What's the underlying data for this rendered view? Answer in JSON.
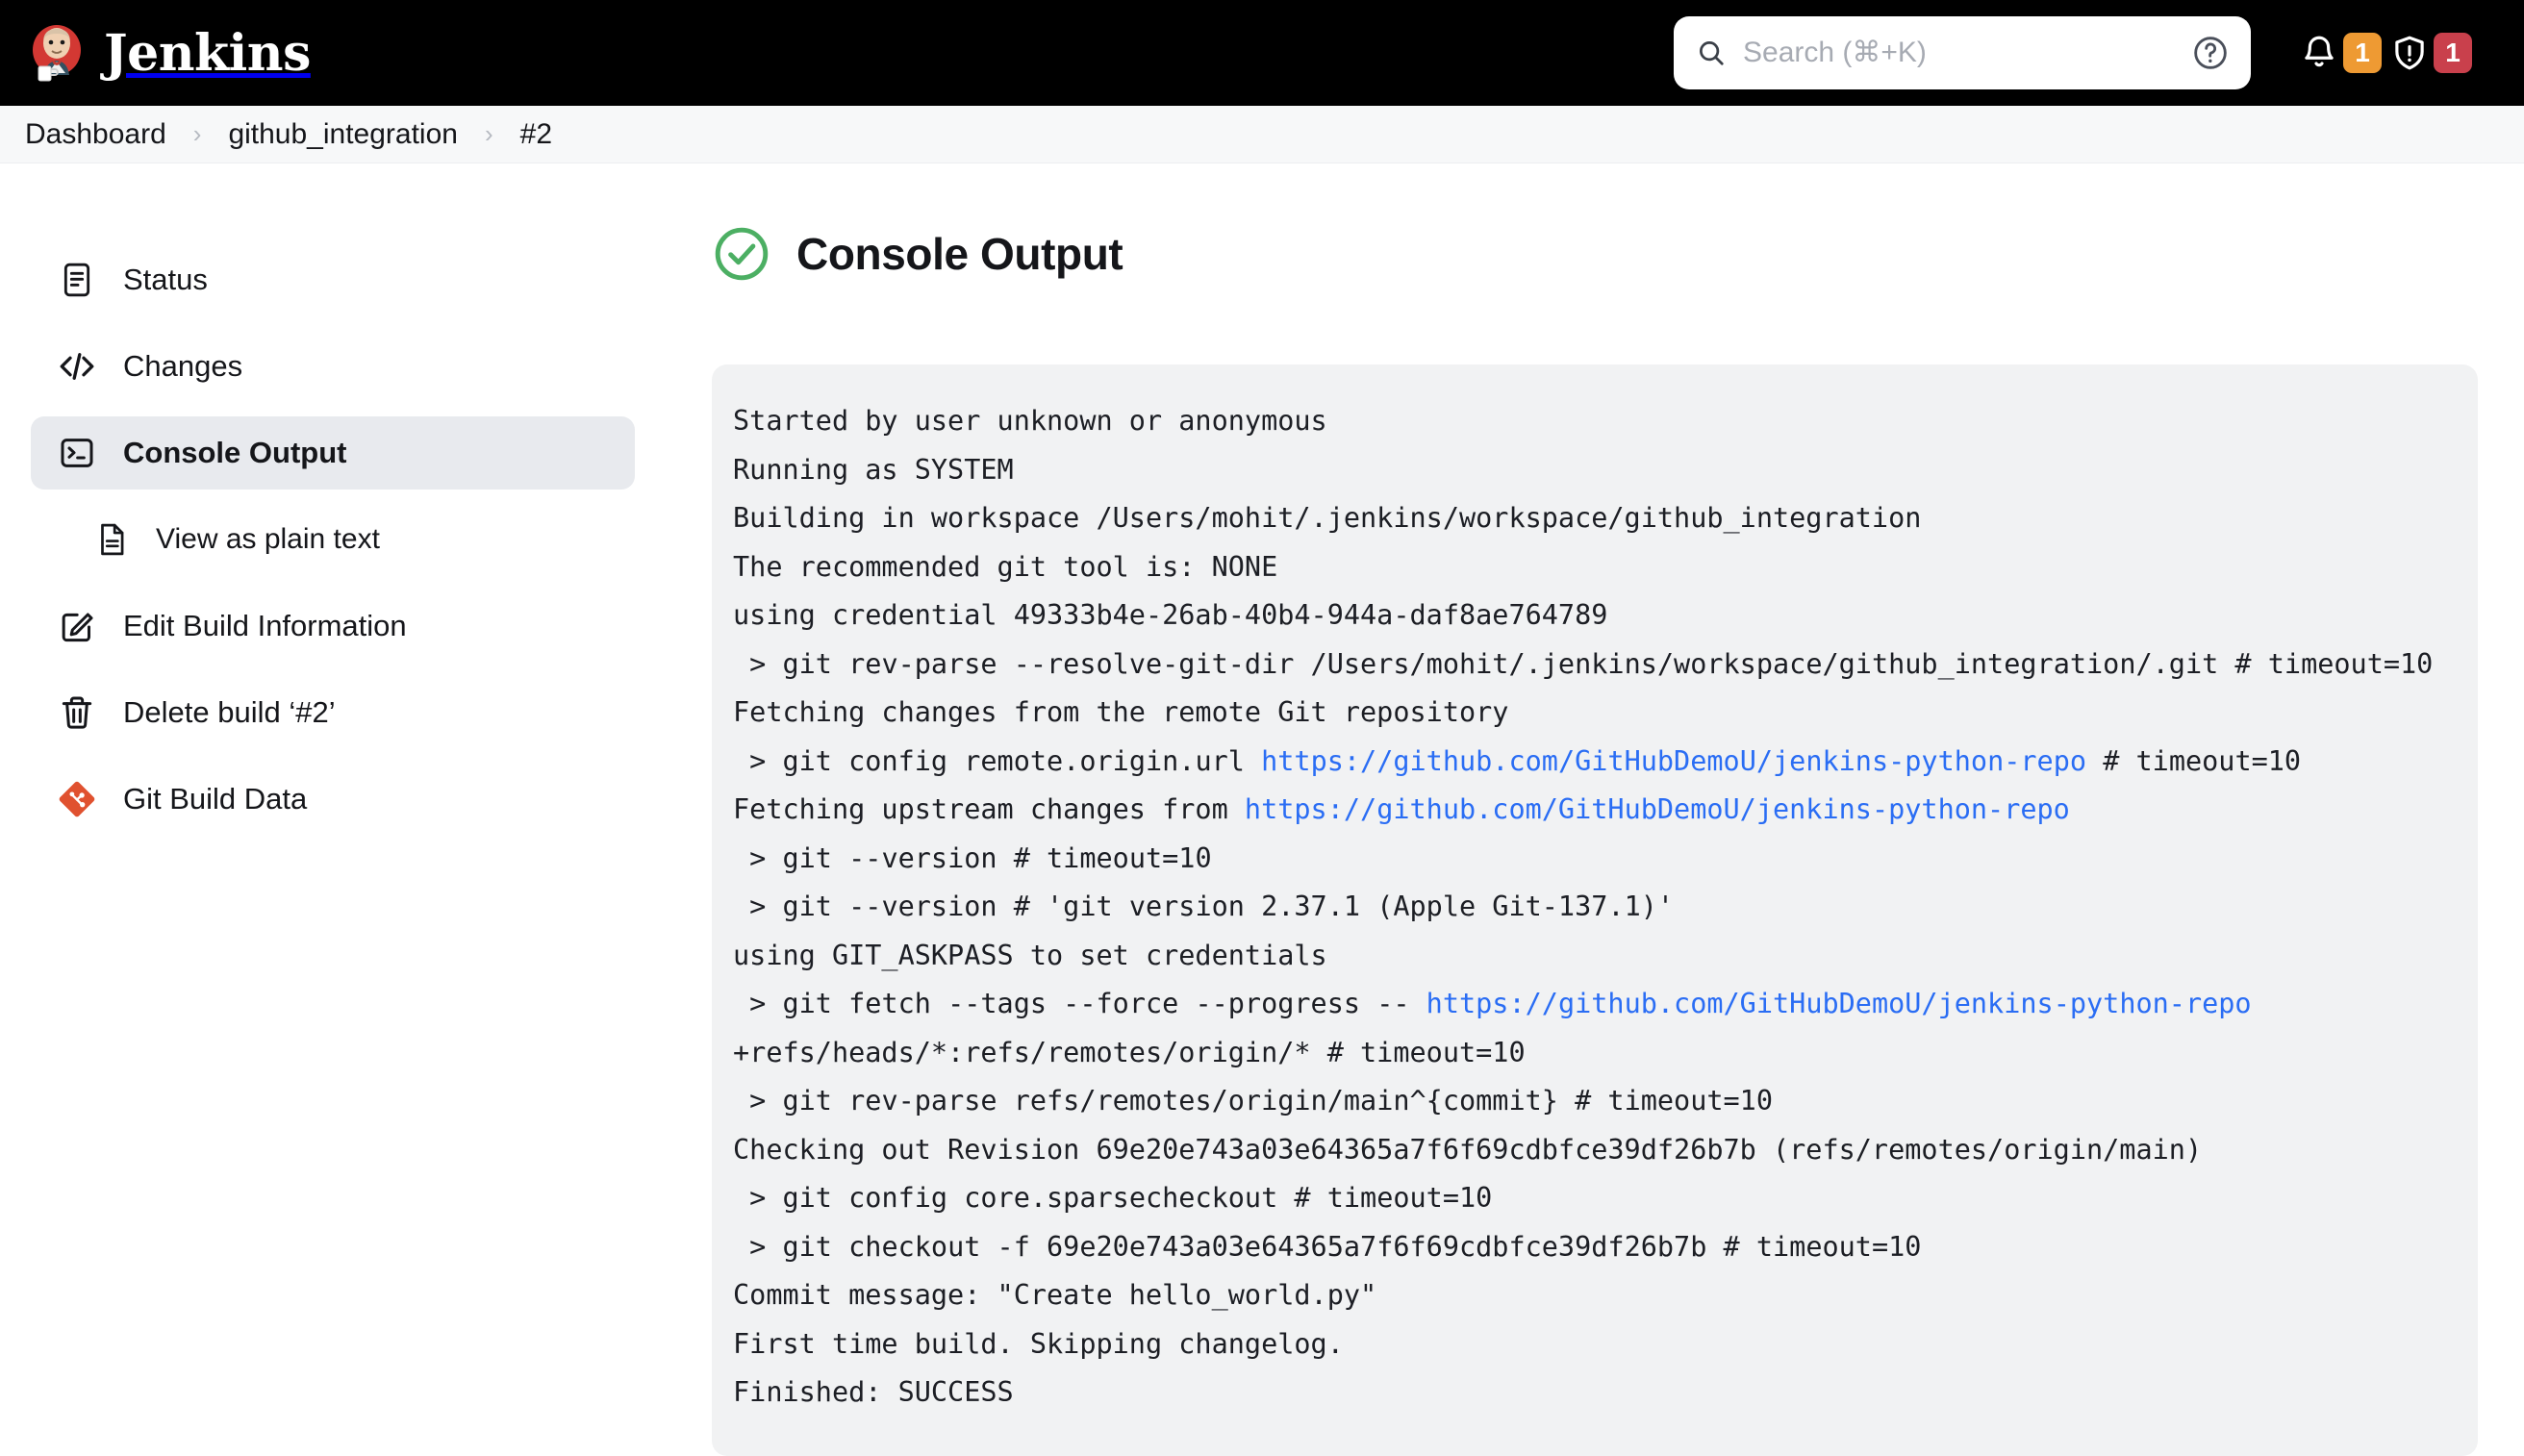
{
  "header": {
    "brand": "Jenkins",
    "brand_logo_icon": "jenkins-butler-logo",
    "search": {
      "placeholder": "Search (⌘+K)",
      "value": "",
      "search_icon": "search-icon",
      "help_icon": "help-circle-icon"
    },
    "notifications": {
      "icon": "bell-icon",
      "count": "1",
      "color": "#ee9a33"
    },
    "security": {
      "icon": "shield-alert-icon",
      "count": "1",
      "color": "#c9404c"
    }
  },
  "breadcrumb": [
    {
      "label": "Dashboard",
      "sep": "›"
    },
    {
      "label": "github_integration",
      "sep": "›"
    },
    {
      "label": "#2",
      "sep": ""
    }
  ],
  "sidebar": {
    "items": [
      {
        "label": "Status",
        "icon": "document-lines-icon",
        "active": false,
        "sub": false
      },
      {
        "label": "Changes",
        "icon": "code-brackets-icon",
        "active": false,
        "sub": false
      },
      {
        "label": "Console Output",
        "icon": "terminal-icon",
        "active": true,
        "sub": false
      },
      {
        "label": "View as plain text",
        "icon": "plain-text-file-icon",
        "active": false,
        "sub": true
      },
      {
        "label": "Edit Build Information",
        "icon": "edit-square-icon",
        "active": false,
        "sub": false
      },
      {
        "label": "Delete build ‘#2’",
        "icon": "trash-icon",
        "active": false,
        "sub": false
      },
      {
        "label": "Git Build Data",
        "icon": "git-logo-icon",
        "active": false,
        "sub": false
      }
    ]
  },
  "main": {
    "title": "Console Output",
    "status_icon": "check-circle-icon",
    "status_color": "#4caf63",
    "repo_url": "https://github.com/GitHubDemoU/jenkins-python-repo",
    "console_lines": [
      {
        "text": "Started by user unknown or anonymous"
      },
      {
        "text": "Running as SYSTEM"
      },
      {
        "text": "Building in workspace /Users/mohit/.jenkins/workspace/github_integration"
      },
      {
        "text": "The recommended git tool is: NONE"
      },
      {
        "text": "using credential 49333b4e-26ab-40b4-944a-daf8ae764789"
      },
      {
        "text": " > git rev-parse --resolve-git-dir /Users/mohit/.jenkins/workspace/github_integration/.git # timeout=10"
      },
      {
        "text": "Fetching changes from the remote Git repository"
      },
      {
        "pre": " > git config remote.origin.url ",
        "link": "https://github.com/GitHubDemoU/jenkins-python-repo",
        "post": " # timeout=10"
      },
      {
        "pre": "Fetching upstream changes from ",
        "link": "https://github.com/GitHubDemoU/jenkins-python-repo",
        "post": ""
      },
      {
        "text": " > git --version # timeout=10"
      },
      {
        "text": " > git --version # 'git version 2.37.1 (Apple Git-137.1)'"
      },
      {
        "text": "using GIT_ASKPASS to set credentials"
      },
      {
        "pre": " > git fetch --tags --force --progress -- ",
        "link": "https://github.com/GitHubDemoU/jenkins-python-repo",
        "post": "\n+refs/heads/*:refs/remotes/origin/* # timeout=10"
      },
      {
        "text": " > git rev-parse refs/remotes/origin/main^{commit} # timeout=10"
      },
      {
        "text": "Checking out Revision 69e20e743a03e64365a7f6f69cdbfce39df26b7b (refs/remotes/origin/main)"
      },
      {
        "text": " > git config core.sparsecheckout # timeout=10"
      },
      {
        "text": " > git checkout -f 69e20e743a03e64365a7f6f69cdbfce39df26b7b # timeout=10"
      },
      {
        "text": "Commit message: \"Create hello_world.py\""
      },
      {
        "text": "First time build. Skipping changelog."
      },
      {
        "text": "Finished: SUCCESS"
      }
    ]
  }
}
